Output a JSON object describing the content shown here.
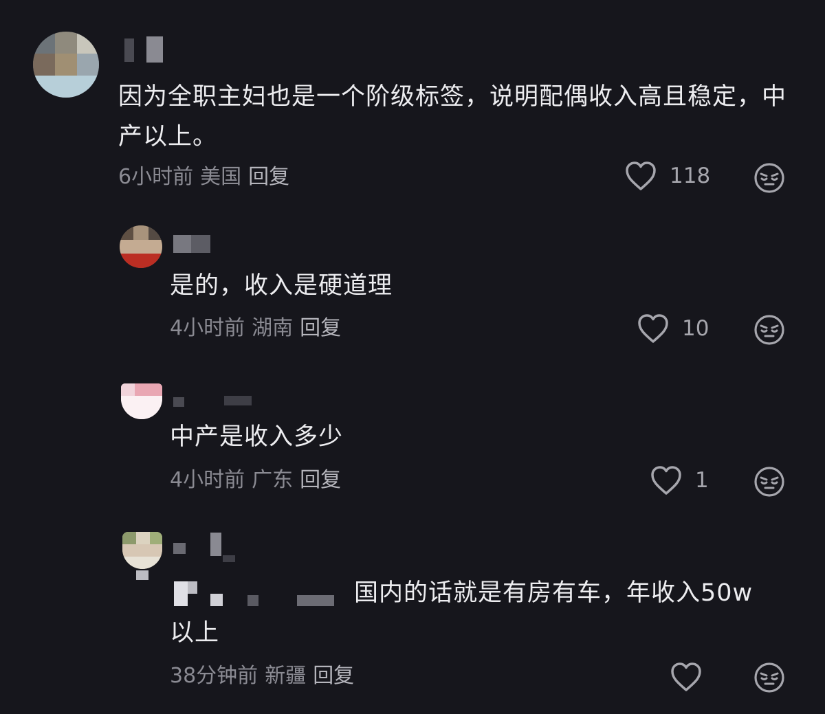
{
  "colors": {
    "background": "#16161c",
    "text": "#ededf0",
    "meta": "#8b8b93",
    "icon": "#a6a6ad"
  },
  "comments": [
    {
      "text": "因为全职主妇也是一个阶级标签，说明配偶收入高且稳定，中产以上。",
      "time": "6小时前",
      "location": "美国",
      "reply_label": "回复",
      "likes": "118",
      "like_icon": "heart-outline",
      "reaction_icon": "sleepy-face"
    },
    {
      "text": "是的，收入是硬道理",
      "time": "4小时前",
      "location": "湖南",
      "reply_label": "回复",
      "likes": "10",
      "like_icon": "heart-outline",
      "reaction_icon": "sleepy-face"
    },
    {
      "text": "中产是收入多少",
      "time": "4小时前",
      "location": "广东",
      "reply_label": "回复",
      "likes": "1",
      "like_icon": "heart-outline",
      "reaction_icon": "sleepy-face"
    },
    {
      "text": "国内的话就是有房有车，年收入50w以上",
      "time": "38分钟前",
      "location": "新疆",
      "reply_label": "回复",
      "likes": "",
      "like_icon": "heart-outline",
      "reaction_icon": "sleepy-face"
    }
  ]
}
